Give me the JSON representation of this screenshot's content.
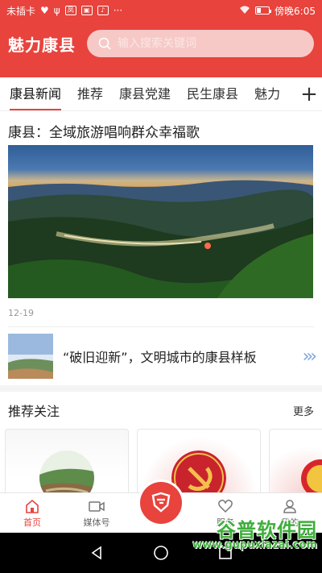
{
  "status_bar": {
    "left_text": "未插卡",
    "notif_1": "凤凰",
    "time": "傍晚6:05"
  },
  "header": {
    "title": "魅力康县",
    "search_placeholder": "输入搜索关键词"
  },
  "tabs": [
    {
      "label": "康县新闻"
    },
    {
      "label": "推荐"
    },
    {
      "label": "康县党建"
    },
    {
      "label": "民生康县"
    },
    {
      "label": "魅力"
    }
  ],
  "headline": {
    "title": "康县：全域旅游唱响群众幸福歌",
    "date": "12-19"
  },
  "carousel": {
    "text": "“破旧迎新”，文明城市的康县样板"
  },
  "recommend": {
    "title": "推荐关注",
    "more": "更多"
  },
  "bottom_nav": {
    "home": "首页",
    "media": "媒体号",
    "service": "服务",
    "mine": "我的"
  },
  "watermark": {
    "brand": "谷普软件园",
    "url": "www.gupuxiazai.com"
  },
  "colors": {
    "brand": "#e8433d"
  }
}
